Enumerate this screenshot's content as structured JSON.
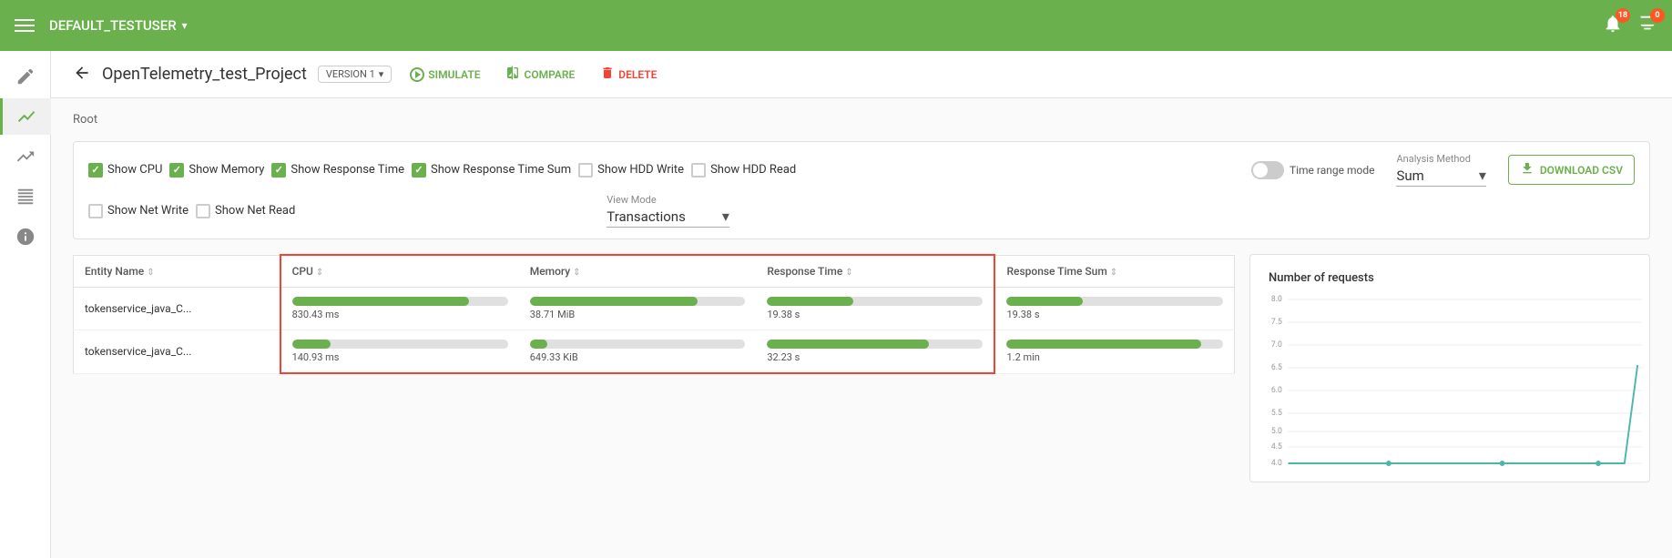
{
  "topNav": {
    "hamburgerLabel": "menu",
    "title": "DEFAULT_TESTUSER",
    "dropdownIcon": "chevron-down",
    "bellBadge": "18",
    "screenBadge": "0"
  },
  "subHeader": {
    "backLabel": "←",
    "projectTitle": "OpenTelemetry_test_Project",
    "versionLabel": "VERSION 1",
    "simulateLabel": "SIMULATE",
    "compareLabel": "COMPARE",
    "deleteLabel": "DELETE"
  },
  "breadcrumb": "Root",
  "filters": {
    "topRow": [
      {
        "id": "cpu",
        "label": "Show CPU",
        "checked": true
      },
      {
        "id": "memory",
        "label": "Show Memory",
        "checked": true
      },
      {
        "id": "responseTime",
        "label": "Show Response Time",
        "checked": true
      },
      {
        "id": "responseTimeSum",
        "label": "Show Response Time Sum",
        "checked": true
      },
      {
        "id": "hddWrite",
        "label": "Show HDD Write",
        "checked": false
      },
      {
        "id": "hddRead",
        "label": "Show HDD Read",
        "checked": false
      }
    ],
    "bottomRow": [
      {
        "id": "netWrite",
        "label": "Show Net Write",
        "checked": false
      },
      {
        "id": "netRead",
        "label": "Show Net Read",
        "checked": false
      }
    ],
    "timeRangeMode": "Time range mode",
    "analysisMethod": {
      "label": "Analysis Method",
      "value": "Sum"
    },
    "viewMode": {
      "label": "View Mode",
      "value": "Transactions"
    },
    "downloadLabel": "DOWNLOAD CSV"
  },
  "table": {
    "columns": [
      {
        "id": "entityName",
        "label": "Entity Name"
      },
      {
        "id": "cpu",
        "label": "CPU"
      },
      {
        "id": "memory",
        "label": "Memory"
      },
      {
        "id": "responseTime",
        "label": "Response Time"
      },
      {
        "id": "responseTimeSum",
        "label": "Response Time Sum"
      }
    ],
    "rows": [
      {
        "entityName": "tokenservice_java_C...",
        "cpuPct": 82,
        "cpuVal": "830.43 ms",
        "memPct": 78,
        "memVal": "38.71 MiB",
        "rtPct": 40,
        "rtVal": "19.38 s",
        "rtsPct": 35,
        "rtsVal": "19.38 s"
      },
      {
        "entityName": "tokenservice_java_C...",
        "cpuPct": 18,
        "cpuVal": "140.93 ms",
        "memPct": 8,
        "memVal": "649.33 KiB",
        "rtPct": 75,
        "rtVal": "32.23 s",
        "rtsPct": 90,
        "rtsVal": "1.2 min"
      }
    ]
  },
  "chart": {
    "title": "Number of requests",
    "yLabels": [
      "8.0",
      "7.5",
      "7.0",
      "6.5",
      "6.0",
      "5.5",
      "5.0",
      "4.5",
      "4.0"
    ],
    "lineColor": "#4db6ac"
  }
}
